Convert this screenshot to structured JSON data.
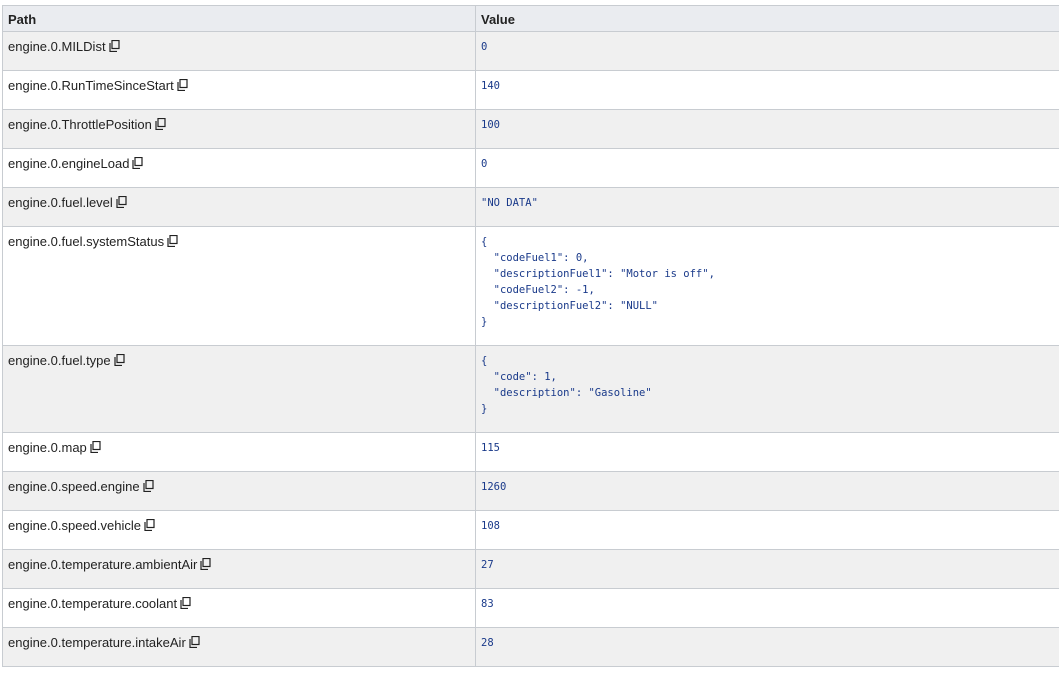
{
  "table": {
    "headers": {
      "path": "Path",
      "value": "Value"
    },
    "rows": [
      {
        "path": "engine.0.MILDist",
        "value": "0"
      },
      {
        "path": "engine.0.RunTimeSinceStart",
        "value": "140"
      },
      {
        "path": "engine.0.ThrottlePosition",
        "value": "100"
      },
      {
        "path": "engine.0.engineLoad",
        "value": "0"
      },
      {
        "path": "engine.0.fuel.level",
        "value": "\"NO DATA\""
      },
      {
        "path": "engine.0.fuel.systemStatus",
        "value": "{\n  \"codeFuel1\": 0,\n  \"descriptionFuel1\": \"Motor is off\",\n  \"codeFuel2\": -1,\n  \"descriptionFuel2\": \"NULL\"\n}"
      },
      {
        "path": "engine.0.fuel.type",
        "value": "{\n  \"code\": 1,\n  \"description\": \"Gasoline\"\n}"
      },
      {
        "path": "engine.0.map",
        "value": "115"
      },
      {
        "path": "engine.0.speed.engine",
        "value": "1260"
      },
      {
        "path": "engine.0.speed.vehicle",
        "value": "108"
      },
      {
        "path": "engine.0.temperature.ambientAir",
        "value": "27"
      },
      {
        "path": "engine.0.temperature.coolant",
        "value": "83"
      },
      {
        "path": "engine.0.temperature.intakeAir",
        "value": "28"
      }
    ]
  },
  "icons": {
    "copy": "copy-icon"
  },
  "colors": {
    "value_text": "#1a3a8a",
    "odd_row": "#f0f0f0",
    "header_bg": "#eaecf0",
    "border": "#c8ccd1"
  }
}
